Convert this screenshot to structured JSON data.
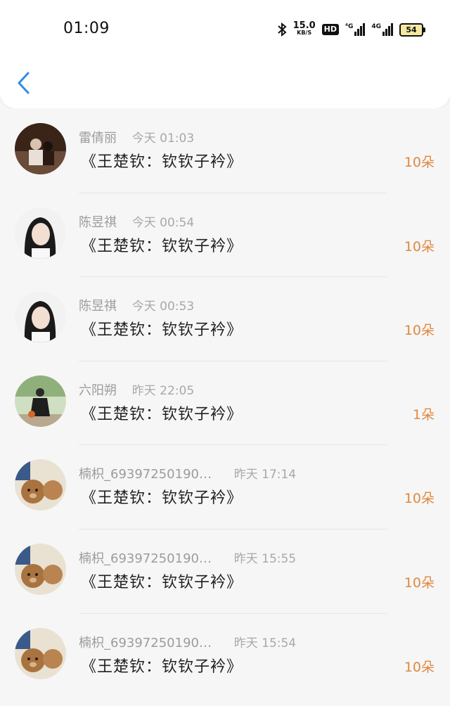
{
  "status_bar": {
    "time": "01:09",
    "speed_value": "15.0",
    "speed_unit": "KB/S",
    "hd_label": "HD",
    "network_1": "⁴G",
    "network_2": "4G",
    "battery": "54"
  },
  "header": {
    "back_icon": "chevron-left-icon"
  },
  "colors": {
    "accent": "#2f8de4",
    "count": "#e0883f"
  },
  "gifts": [
    {
      "name": "雷倩丽",
      "time": "今天 01:03",
      "title": "《王楚钦：钦钦子衿》",
      "count": "10朵",
      "avatar": "avatar-couple-dark"
    },
    {
      "name": "陈昱祺",
      "time": "今天 00:54",
      "title": "《王楚钦：钦钦子衿》",
      "count": "10朵",
      "avatar": "avatar-woman-portrait"
    },
    {
      "name": "陈昱祺",
      "time": "今天 00:53",
      "title": "《王楚钦：钦钦子衿》",
      "count": "10朵",
      "avatar": "avatar-woman-portrait"
    },
    {
      "name": "六阳朔",
      "time": "昨天 22:05",
      "title": "《王楚钦：钦钦子衿》",
      "count": "1朵",
      "avatar": "avatar-person-outdoor"
    },
    {
      "name": "楠枳_69397250190…",
      "time": "昨天 17:14",
      "title": "《王楚钦：钦钦子衿》",
      "count": "10朵",
      "avatar": "avatar-teddy-bears"
    },
    {
      "name": "楠枳_69397250190…",
      "time": "昨天 15:55",
      "title": "《王楚钦：钦钦子衿》",
      "count": "10朵",
      "avatar": "avatar-teddy-bears"
    },
    {
      "name": "楠枳_69397250190…",
      "time": "昨天 15:54",
      "title": "《王楚钦：钦钦子衿》",
      "count": "10朵",
      "avatar": "avatar-teddy-bears"
    }
  ]
}
